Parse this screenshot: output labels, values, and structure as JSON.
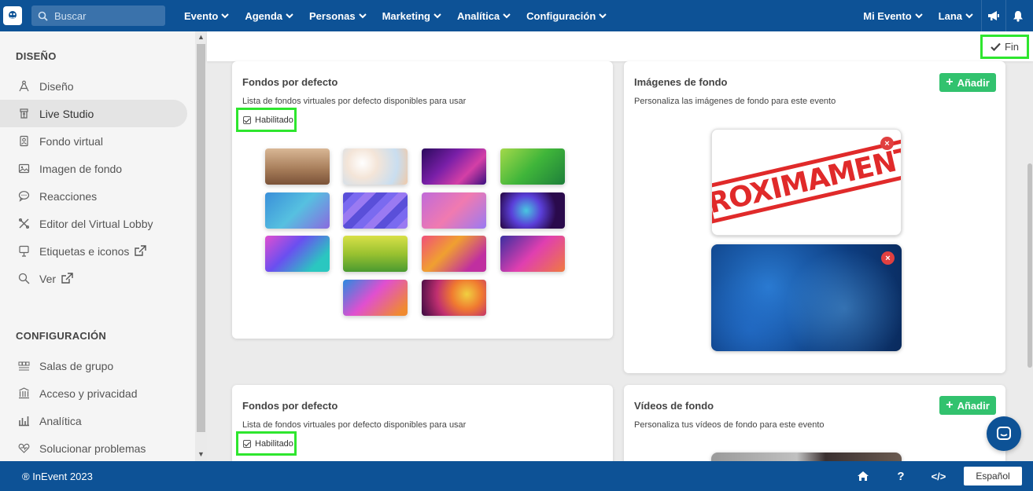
{
  "topbar": {
    "logo_icon": "inevent-logo-icon",
    "search_placeholder": "Buscar",
    "menu": [
      "Evento",
      "Agenda",
      "Personas",
      "Marketing",
      "Analítica",
      "Configuración"
    ],
    "event_selector": "Mi Evento",
    "user_menu": "Lana",
    "announce_icon": "megaphone-icon",
    "notifications_icon": "bell-icon"
  },
  "sidebar": {
    "section1": "DISEÑO",
    "items1": [
      {
        "label": "Diseño",
        "icon": "compass-icon"
      },
      {
        "label": "Live Studio",
        "icon": "studio-icon",
        "active": true
      },
      {
        "label": "Fondo virtual",
        "icon": "portrait-icon"
      },
      {
        "label": "Imagen de fondo",
        "icon": "image-icon"
      },
      {
        "label": "Reacciones",
        "icon": "comment-icon"
      },
      {
        "label": "Editor del Virtual Lobby",
        "icon": "tools-icon"
      },
      {
        "label": "Etiquetas e iconos",
        "icon": "sign-icon",
        "external": true
      },
      {
        "label": "Ver",
        "icon": "search-icon",
        "external": true
      }
    ],
    "section2": "CONFIGURACIÓN",
    "items2": [
      {
        "label": "Salas de grupo",
        "icon": "groups-icon"
      },
      {
        "label": "Acceso y privacidad",
        "icon": "building-icon"
      },
      {
        "label": "Analítica",
        "icon": "chart-icon"
      },
      {
        "label": "Solucionar problemas",
        "icon": "heartbeat-icon"
      }
    ]
  },
  "header": {
    "fin_label": "Fin"
  },
  "cards": {
    "default_bg_1": {
      "title": "Fondos por defecto",
      "desc": "Lista de fondos virtuales por defecto disponibles para usar",
      "enabled_label": "Habilitado"
    },
    "bg_images": {
      "title": "Imágenes de fondo",
      "desc": "Personaliza las imágenes de fondo para este evento",
      "add_label": "Añadir",
      "stamp_text": "PROXIMAMENTE"
    },
    "default_bg_2": {
      "title": "Fondos por defecto",
      "desc": "Lista de fondos virtuales por defecto disponibles para usar",
      "enabled_label": "Habilitado"
    },
    "bg_videos": {
      "title": "Vídeos de fondo",
      "desc": "Personaliza tus vídeos de fondo para este evento",
      "add_label": "Añadir"
    }
  },
  "footer": {
    "copyright": "® InEvent 2023",
    "language": "Español",
    "help_label": "?",
    "code_label": "</>"
  },
  "colors": {
    "nav_bg": "#0d5296",
    "accent_green": "#32c26e",
    "highlight": "#2ee62e",
    "close_red": "#e04040"
  }
}
